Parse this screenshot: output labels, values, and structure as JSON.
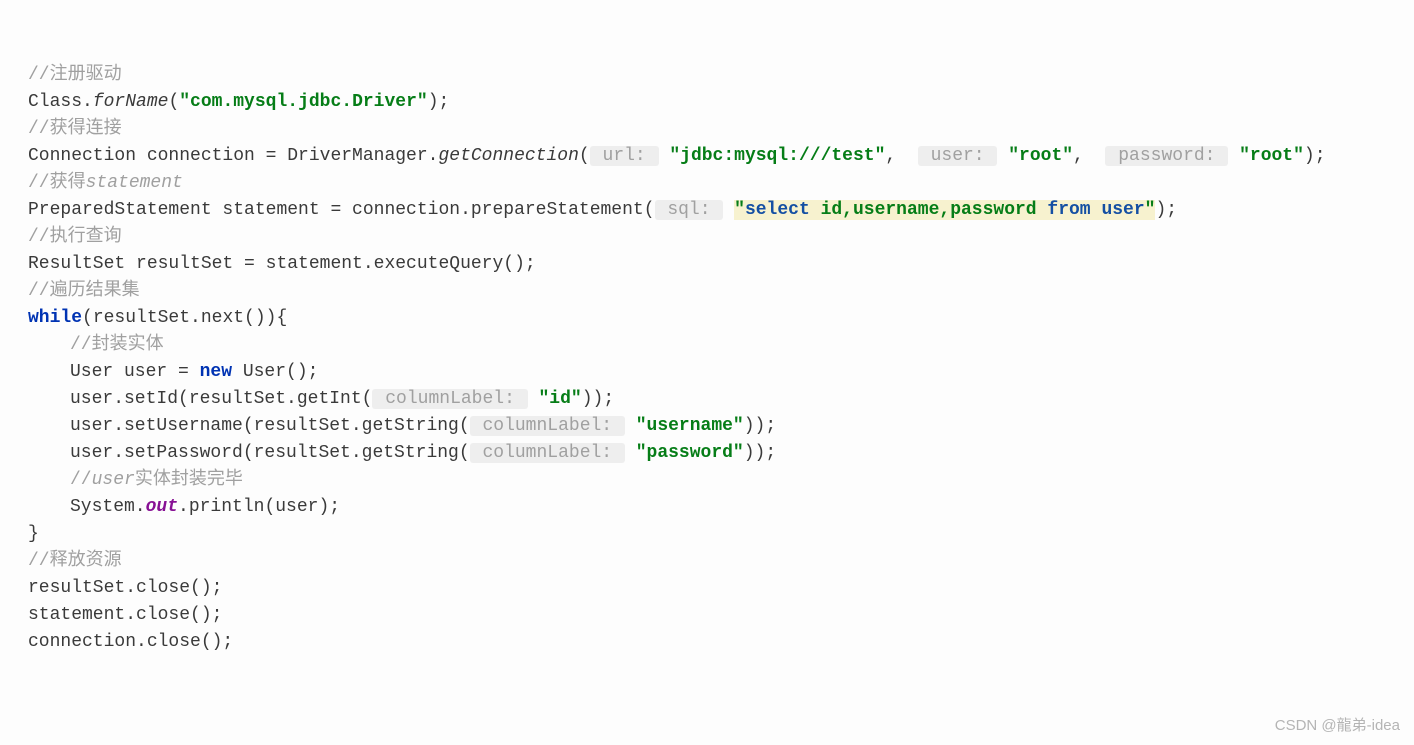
{
  "watermark": "CSDN @龍弟-idea",
  "c": {
    "comment1": "//注册驱动",
    "l2a": "Class.",
    "l2b": "forName",
    "l2c": "(",
    "l2d": "\"com.mysql.jdbc.Driver\"",
    "l2e": ");",
    "comment2": "//获得连接",
    "l4a": "Connection connection = DriverManager.",
    "l4b": "getConnection",
    "l4c": "(",
    "hint_url": " url: ",
    "l4url": "\"jdbc:mysql:///test\"",
    "l4d": ",  ",
    "hint_user": " user: ",
    "l4user": "\"root\"",
    "l4e": ",  ",
    "hint_pw": " password: ",
    "l4pw": "\"root\"",
    "l4f": ");",
    "comment3a": "//获得",
    "comment3b": "statement",
    "l6a": "PreparedStatement statement = connection.prepareStatement(",
    "hint_sql": " sql: ",
    "sql_q1": "\"",
    "sql_kw1": "select",
    "sql_m": " id,username,password ",
    "sql_kw2": "from",
    "sql_sp": " ",
    "sql_kw3": "user",
    "sql_q2": "\"",
    "l6b": ");",
    "comment4": "//执行查询",
    "l8": "ResultSet resultSet = statement.executeQuery();",
    "comment5": "//遍历结果集",
    "kw_while": "while",
    "l10": "(resultSet.next()){",
    "comment6": "//封装实体",
    "l12a": "User user = ",
    "kw_new": "new",
    "l12b": " User();",
    "l13a": "user.setId(resultSet.getInt(",
    "hint_cl1": " columnLabel: ",
    "l13b": "\"id\"",
    "l13c": "));",
    "l14a": "user.setUsername(resultSet.getString(",
    "hint_cl2": " columnLabel: ",
    "l14b": "\"username\"",
    "l14c": "));",
    "l15a": "user.setPassword(resultSet.getString(",
    "hint_cl3": " columnLabel: ",
    "l15b": "\"password\"",
    "l15c": "));",
    "comment7a": "//",
    "comment7b": "user",
    "comment7c": "实体封装完毕",
    "l17a": "System.",
    "l17b": "out",
    "l17c": ".println(user);",
    "l18": "}",
    "comment8": "//释放资源",
    "l20": "resultSet.close();",
    "l21": "statement.close();",
    "l22": "connection.close();"
  }
}
